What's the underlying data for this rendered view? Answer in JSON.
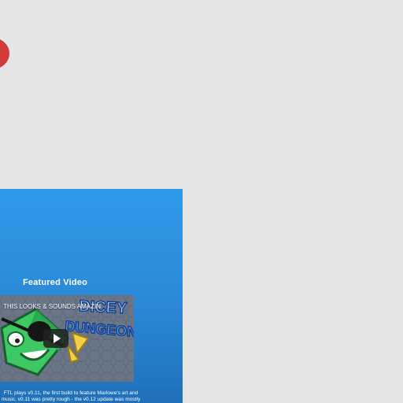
{
  "featured_video": {
    "heading": "Featured Video",
    "video_title": "THIS LOOKS & SOUNDS AMAZIN",
    "logo_text_line1": "DICEY",
    "logo_text_line2": "DUNGEONS",
    "play_icon": "play-icon",
    "description_line1": "FTL plays v0.11, the first build to feature Marlowe's art and",
    "description_line2": "music. v0.11 was pretty rough - the v0.12 update was mostly"
  },
  "colors": {
    "background": "#e6e6e6",
    "panel_top": "#2f9ae9",
    "panel_bottom": "#1f6fb9",
    "accent_red": "#d33b3b",
    "character_green": "#3cc964",
    "logo_blue": "#2d72d9"
  }
}
